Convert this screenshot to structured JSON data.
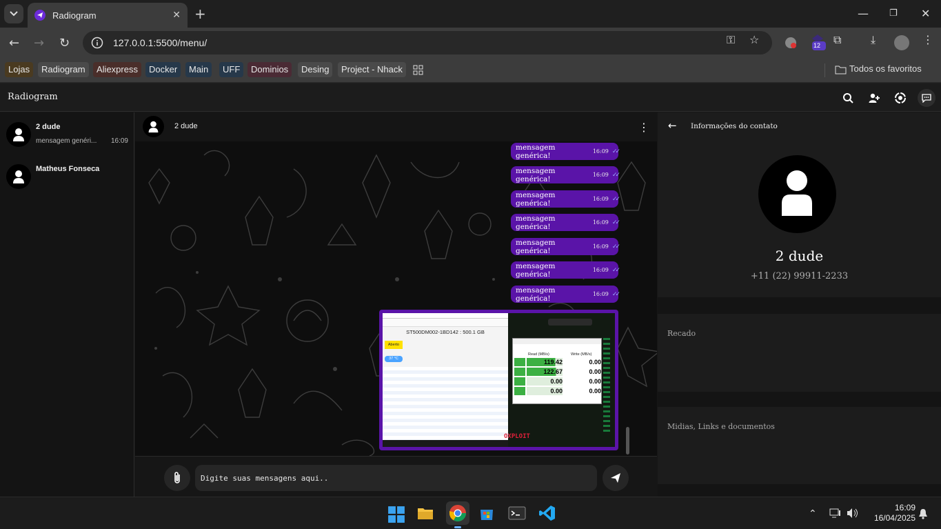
{
  "browser": {
    "tab_title": "Radiogram",
    "url": "127.0.0.1:5500/menu/",
    "extension_badge": "12",
    "bookmarks": [
      {
        "label": "Lojas",
        "color": "#4a3a20"
      },
      {
        "label": "Radiogram",
        "color": "#4a4a4a"
      },
      {
        "label": "Aliexpress",
        "color": "#4a2e2a"
      },
      {
        "label": "Docker",
        "color": "#26384a"
      },
      {
        "label": "Main",
        "color": "#26384a"
      },
      {
        "label": "UFF",
        "color": "#26384a"
      },
      {
        "label": "Dominios",
        "color": "#4a2a34"
      },
      {
        "label": "Desing",
        "color": "#4a4a4a"
      },
      {
        "label": "Project - Nhack",
        "color": "#4a4a4a"
      }
    ],
    "all_bookmarks_label": "Todos os favoritos"
  },
  "app": {
    "brand": "Radiogram",
    "accent": "#5a14a8"
  },
  "contacts": [
    {
      "name": "2 dude",
      "last_message": "mensagem genéri...",
      "time": "16:09"
    },
    {
      "name": "Matheus Fonseca",
      "last_message": "",
      "time": ""
    }
  ],
  "chat": {
    "contact_name": "2 dude",
    "messages": [
      {
        "text": "mensagem genérica!",
        "time": "16:09"
      },
      {
        "text": "mensagem genérica!",
        "time": "16:09"
      },
      {
        "text": "mensagem genérica!",
        "time": "16:09"
      },
      {
        "text": "mensagem genérica!",
        "time": "16:09"
      },
      {
        "text": "mensagem genérica!",
        "time": "16:09"
      },
      {
        "text": "mensagem genérica!",
        "time": "16:09"
      },
      {
        "text": "mensagem genérica!",
        "time": "16:09"
      }
    ],
    "input_placeholder": "Digite suas mensagens aqui.."
  },
  "image_message": {
    "disk_title": "ST500DM002-1BD142 : 500.1 GB",
    "status": "Aberto",
    "temperature": "37 °C",
    "bench_headers": [
      "Read (MB/s)",
      "Write (MB/s)"
    ],
    "bench_rows": [
      {
        "read": "119.42",
        "write": "0.00"
      },
      {
        "read": "122.67",
        "write": "0.00"
      },
      {
        "read": "0.00",
        "write": "0.00"
      },
      {
        "read": "0.00",
        "write": "0.00"
      }
    ],
    "banner": "OXPLOIT"
  },
  "info_panel": {
    "title": "Informações do contato",
    "name": "2 dude",
    "phone": "+11 (22) 99911-2233",
    "sections": [
      "Recado",
      "Midias, Links e documentos"
    ]
  },
  "taskbar": {
    "time": "16:09",
    "date": "16/04/2025"
  }
}
